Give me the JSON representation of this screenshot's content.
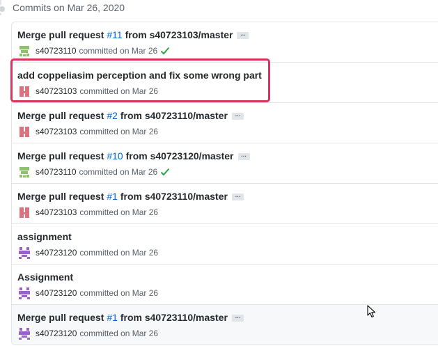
{
  "group": {
    "header": "Commits on Mar 26, 2020"
  },
  "ellipsis_label": "…",
  "commits": [
    {
      "title_prefix": "Merge pull request ",
      "pr": "#11",
      "title_suffix": " from s40723103/master",
      "has_ellipsis": true,
      "author": "s40723110",
      "committed": "committed on Mar 26",
      "avatar": "green",
      "verified": true
    },
    {
      "title_prefix": "add coppeliasim perception and fix some wrong part",
      "pr": "",
      "title_suffix": "",
      "has_ellipsis": false,
      "author": "s40723103",
      "committed": "committed on Mar 26",
      "avatar": "red",
      "verified": false
    },
    {
      "title_prefix": "Merge pull request ",
      "pr": "#2",
      "title_suffix": " from s40723110/master",
      "has_ellipsis": true,
      "author": "s40723103",
      "committed": "committed on Mar 26",
      "avatar": "red",
      "verified": false
    },
    {
      "title_prefix": "Merge pull request ",
      "pr": "#10",
      "title_suffix": " from s40723120/master",
      "has_ellipsis": true,
      "author": "s40723110",
      "committed": "committed on Mar 26",
      "avatar": "green",
      "verified": true
    },
    {
      "title_prefix": "Merge pull request ",
      "pr": "#1",
      "title_suffix": " from s40723110/master",
      "has_ellipsis": true,
      "author": "s40723103",
      "committed": "committed on Mar 26",
      "avatar": "red",
      "verified": false
    },
    {
      "title_prefix": "assignment",
      "pr": "",
      "title_suffix": "",
      "has_ellipsis": false,
      "author": "s40723120",
      "committed": "committed on Mar 26",
      "avatar": "purple",
      "verified": false
    },
    {
      "title_prefix": "Assignment",
      "pr": "",
      "title_suffix": "",
      "has_ellipsis": false,
      "author": "s40723120",
      "committed": "committed on Mar 26",
      "avatar": "purple",
      "verified": false
    },
    {
      "title_prefix": "Merge pull request ",
      "pr": "#1",
      "title_suffix": " from s40723110/master",
      "has_ellipsis": true,
      "author": "s40723120",
      "committed": "committed on Mar 26",
      "avatar": "purple",
      "verified": false
    }
  ],
  "colors": {
    "link": "#0366d6",
    "highlight": "#d9345a",
    "verified": "#28a745",
    "avatar_green": "#8cc26b",
    "avatar_red": "#d9737f",
    "avatar_purple": "#9a62c8"
  },
  "icons": {
    "avatar": "identicon-avatar",
    "verified": "check-icon",
    "cursor": "mouse-pointer-icon"
  }
}
